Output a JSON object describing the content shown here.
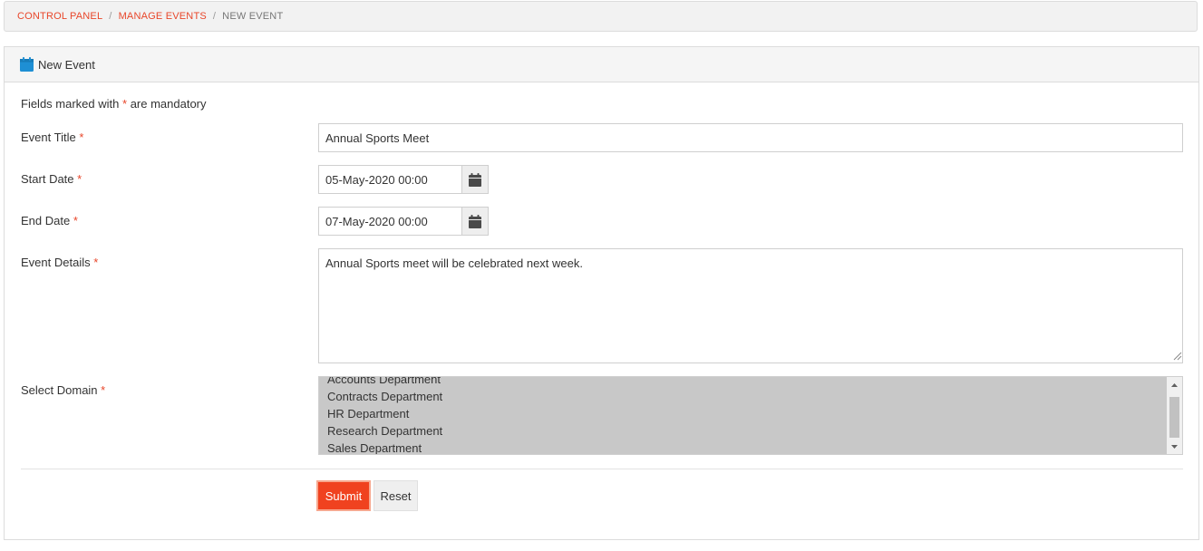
{
  "breadcrumb": {
    "items": [
      "CONTROL PANEL",
      "MANAGE EVENTS"
    ],
    "separator": "/",
    "current": "NEW EVENT"
  },
  "panel": {
    "title": "New Event",
    "icon": "calendar-icon"
  },
  "form": {
    "mandatory_note_prefix": "Fields marked with",
    "mandatory_note_suffix": "are mandatory",
    "required_marker": "*",
    "event_title": {
      "label": "Event Title",
      "value": "Annual Sports Meet"
    },
    "start_date": {
      "label": "Start Date",
      "value": "05-May-2020 00:00"
    },
    "end_date": {
      "label": "End Date",
      "value": "07-May-2020 00:00"
    },
    "event_details": {
      "label": "Event Details",
      "value": "Annual Sports meet will be celebrated next week."
    },
    "select_domain": {
      "label": "Select Domain",
      "options": [
        "Accounts Department",
        "Contracts Department",
        "HR Department",
        "Research Department",
        "Sales Department"
      ]
    }
  },
  "buttons": {
    "submit": "Submit",
    "reset": "Reset"
  },
  "colors": {
    "accent": "#e8462a",
    "submit_bg": "#f0421f",
    "selected_bg": "#c8c8c8",
    "icon_blue": "#1e8fd4"
  }
}
